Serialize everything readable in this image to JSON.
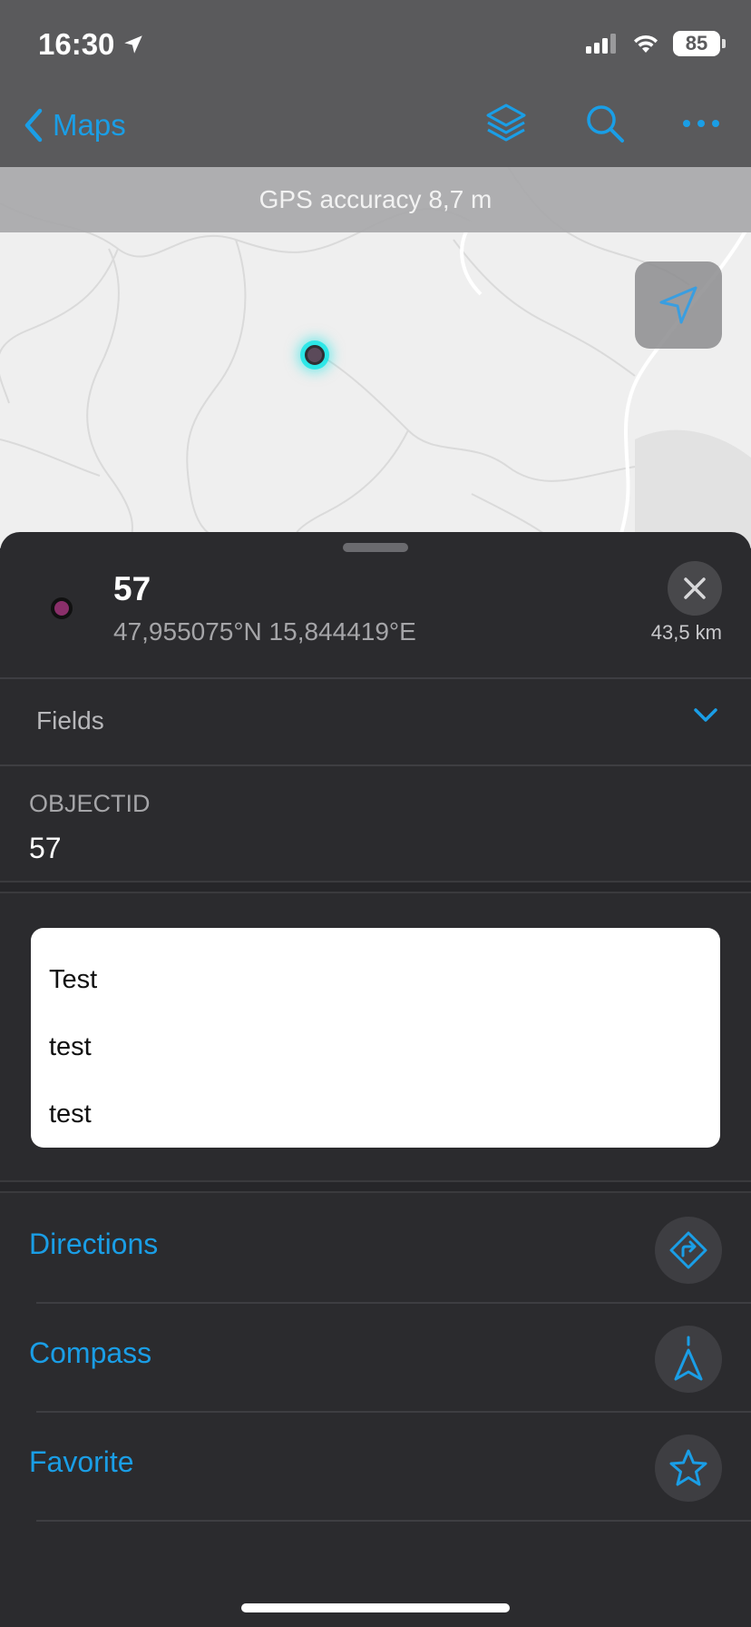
{
  "status": {
    "time": "16:30",
    "battery": "85"
  },
  "nav": {
    "back_label": "Maps"
  },
  "map": {
    "gps_banner": "GPS accuracy 8,7 m"
  },
  "feature": {
    "title": "57",
    "coords": "47,955075°N  15,844419°E",
    "distance": "43,5 km"
  },
  "fields": {
    "label": "Fields"
  },
  "attributes": {
    "objectid_label": "OBJECTID",
    "objectid_value": "57"
  },
  "text_lines": [
    "Test",
    "test",
    "test"
  ],
  "actions": [
    {
      "label": "Directions",
      "icon": "directions-icon"
    },
    {
      "label": "Compass",
      "icon": "compass-icon"
    },
    {
      "label": "Favorite",
      "icon": "star-icon"
    }
  ],
  "colors": {
    "accent": "#1a9ee6",
    "sheet": "#2b2b2e",
    "nav": "#5a5a5c"
  }
}
